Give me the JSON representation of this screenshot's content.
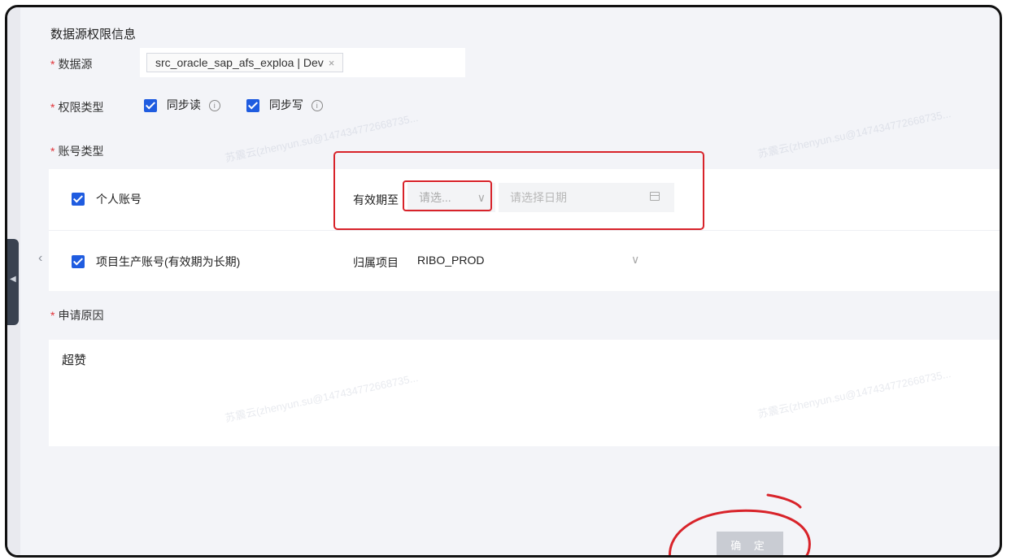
{
  "section_title": "数据源权限信息",
  "datasource": {
    "label": "数据源",
    "tag": "src_oracle_sap_afs_exploa | Dev",
    "tag_close": "×"
  },
  "permission": {
    "label": "权限类型",
    "options": [
      {
        "label": "同步读"
      },
      {
        "label": "同步写"
      }
    ],
    "info_glyph": "i"
  },
  "account_type": {
    "label": "账号类型",
    "personal": {
      "label": "个人账号",
      "expiry_label": "有效期至",
      "expiry_select_placeholder": "请选...",
      "date_placeholder": "请选择日期"
    },
    "project": {
      "label": "项目生产账号(有效期为长期)",
      "owner_label": "归属项目",
      "owner_value": "RIBO_PROD"
    }
  },
  "reason": {
    "label": "申请原因",
    "value": "超赞"
  },
  "confirm_button": "确 定",
  "required_mark": "*",
  "chevron_glyph": "∨",
  "watermark": "苏震云(zhenyun.su@147434772668735...",
  "colors": {
    "accent": "#1f5ce0",
    "required": "#e2343a",
    "annotation": "#d8232a"
  }
}
